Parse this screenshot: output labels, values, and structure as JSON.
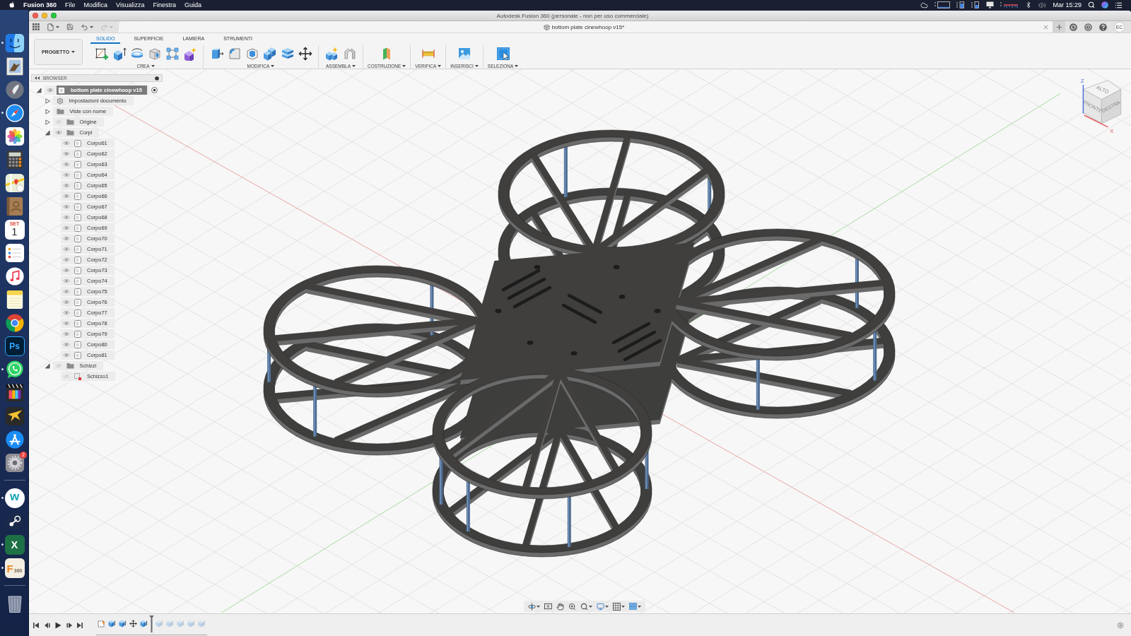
{
  "menu_bar": {
    "app_name": "Fusion 360",
    "menus": [
      "File",
      "Modifica",
      "Visualizza",
      "Finestra",
      "Guida"
    ],
    "clock": "Mar 15:29"
  },
  "dock": {
    "apps": [
      {
        "kind": "face",
        "running": true
      },
      {
        "kind": "stamp",
        "running": false
      },
      {
        "kind": "rocket",
        "running": false
      },
      {
        "kind": "compass",
        "running": true
      },
      {
        "kind": "flower",
        "running": false
      },
      {
        "kind": "calculator",
        "running": false
      },
      {
        "kind": "map",
        "running": false
      },
      {
        "kind": "book",
        "running": false
      },
      {
        "kind": "calendar",
        "month": "SET",
        "day": "1",
        "running": false
      },
      {
        "kind": "checklist",
        "running": false
      },
      {
        "kind": "note",
        "running": false
      },
      {
        "kind": "notepad",
        "running": false
      },
      {
        "kind": "wheel",
        "running": false
      },
      {
        "kind": "outlined-letter",
        "text": "Ps",
        "running": false
      },
      {
        "kind": "chat",
        "running": true
      },
      {
        "kind": "film",
        "running": false
      },
      {
        "kind": "bird",
        "running": false
      },
      {
        "kind": "sticks",
        "running": false
      },
      {
        "kind": "gear",
        "badge": "2",
        "running": false
      }
    ],
    "recent": [
      {
        "kind": "letter-circle",
        "text": "w",
        "running": true
      },
      {
        "kind": "linked-circles",
        "running": false
      },
      {
        "kind": "sheet-letter",
        "text": "X",
        "running": true
      },
      {
        "kind": "cream-letter",
        "text": "F",
        "subtext": "360",
        "running": true
      }
    ]
  },
  "window": {
    "title": "Autodesk Fusion 360 (personale - non per uso commerciale)"
  },
  "quick_access": [
    {
      "kind": "apps",
      "menu": false,
      "disabled": false
    },
    {
      "kind": "file",
      "menu": true,
      "disabled": false
    },
    {
      "kind": "save",
      "menu": false,
      "disabled": false
    },
    {
      "kind": "undo",
      "menu": true,
      "disabled": false
    },
    {
      "kind": "redo",
      "menu": true,
      "disabled": true
    }
  ],
  "document_tab": {
    "label": "bottom plate cinewhoop v15*"
  },
  "account": {
    "initials": "EC"
  },
  "toolbar": {
    "project": "PROGETTO",
    "tabs": [
      {
        "label": "SOLIDO",
        "selected": true
      },
      {
        "label": "SUPERFICIE",
        "selected": false
      },
      {
        "label": "LAMIERA",
        "selected": false
      },
      {
        "label": "STRUMENTI",
        "selected": false
      }
    ],
    "groups": [
      {
        "label": "CREA",
        "tools": [
          {
            "kind": "sketch"
          },
          {
            "kind": "extrude"
          },
          {
            "kind": "revolve"
          },
          {
            "kind": "hole"
          },
          {
            "kind": "pattern"
          },
          {
            "kind": "form"
          }
        ]
      },
      {
        "label": "MODIFICA",
        "tools": [
          {
            "kind": "press-pull"
          },
          {
            "kind": "fillet"
          },
          {
            "kind": "shell"
          },
          {
            "kind": "combine"
          },
          {
            "kind": "offset"
          },
          {
            "kind": "move"
          }
        ]
      },
      {
        "label": "ASSEMBLA",
        "tools": [
          {
            "kind": "component"
          },
          {
            "kind": "joint"
          }
        ]
      },
      {
        "label": "COSTRUZIONE",
        "tools": [
          {
            "kind": "plane"
          }
        ]
      },
      {
        "label": "VERIFICA",
        "tools": [
          {
            "kind": "measure"
          }
        ]
      },
      {
        "label": "INSERISCI",
        "tools": [
          {
            "kind": "image"
          }
        ]
      },
      {
        "label": "SELEZIONA",
        "tools": [
          {
            "kind": "select"
          }
        ]
      }
    ]
  },
  "browser": {
    "title": "BROWSER",
    "root": {
      "kind": "component",
      "label": "bottom plate cinewhoop v15",
      "expanded": true,
      "visible": true,
      "active": true,
      "children": [
        {
          "kind": "settings",
          "label": "Impostazioni documento",
          "expanded": false
        },
        {
          "kind": "folder",
          "label": "Viste con nome",
          "expanded": false
        },
        {
          "kind": "folder",
          "label": "Origine",
          "expanded": false,
          "visible": false
        },
        {
          "kind": "folder",
          "label": "Corpi",
          "expanded": true,
          "visible": true,
          "children": [
            {
              "kind": "body",
              "label": "Corpo61",
              "visible": true
            },
            {
              "kind": "body",
              "label": "Corpo62",
              "visible": true
            },
            {
              "kind": "body",
              "label": "Corpo63",
              "visible": true
            },
            {
              "kind": "body",
              "label": "Corpo64",
              "visible": true
            },
            {
              "kind": "body",
              "label": "Corpo65",
              "visible": true
            },
            {
              "kind": "body",
              "label": "Corpo66",
              "visible": true
            },
            {
              "kind": "body",
              "label": "Corpo67",
              "visible": true
            },
            {
              "kind": "body",
              "label": "Corpo68",
              "visible": true
            },
            {
              "kind": "body",
              "label": "Corpo69",
              "visible": true
            },
            {
              "kind": "body",
              "label": "Corpo70",
              "visible": true
            },
            {
              "kind": "body",
              "label": "Corpo71",
              "visible": true
            },
            {
              "kind": "body",
              "label": "Corpo72",
              "visible": true
            },
            {
              "kind": "body",
              "label": "Corpo73",
              "visible": true
            },
            {
              "kind": "body",
              "label": "Corpo74",
              "visible": true
            },
            {
              "kind": "body",
              "label": "Corpo75",
              "visible": true
            },
            {
              "kind": "body",
              "label": "Corpo76",
              "visible": true
            },
            {
              "kind": "body",
              "label": "Corpo77",
              "visible": true
            },
            {
              "kind": "body",
              "label": "Corpo78",
              "visible": true
            },
            {
              "kind": "body",
              "label": "Corpo79",
              "visible": true
            },
            {
              "kind": "body",
              "label": "Corpo80",
              "visible": true
            },
            {
              "kind": "body",
              "label": "Corpo81",
              "visible": true
            }
          ]
        },
        {
          "kind": "folder",
          "label": "Schizzi",
          "expanded": true,
          "visible": false,
          "children": [
            {
              "kind": "sketch",
              "label": "Schizzo1",
              "visible": false
            }
          ]
        }
      ]
    }
  },
  "viewcube": {
    "top": "ALTO",
    "front": "FRONTE",
    "right": "DESTRA",
    "axis_vertical": "Z",
    "axis_horizontal": "X"
  },
  "navigation_bar": {
    "tools": [
      {
        "kind": "orbit",
        "menu": true
      },
      {
        "kind": "look-at",
        "menu": false
      },
      {
        "kind": "pan",
        "menu": false
      },
      {
        "kind": "zoom",
        "menu": false
      },
      {
        "kind": "fit",
        "menu": true
      },
      {
        "kind": "display",
        "menu": true
      },
      {
        "kind": "grid",
        "menu": true
      },
      {
        "kind": "viewports",
        "menu": true
      }
    ]
  },
  "timeline": {
    "features": [
      {
        "kind": "sketch",
        "rolled_back": false
      },
      {
        "kind": "extrude",
        "rolled_back": false
      },
      {
        "kind": "extrude",
        "rolled_back": false
      },
      {
        "kind": "move",
        "rolled_back": false
      },
      {
        "kind": "extrude",
        "rolled_back": false
      },
      {
        "kind": "extrude",
        "rolled_back": true
      },
      {
        "kind": "extrude",
        "rolled_back": true
      },
      {
        "kind": "extrude",
        "rolled_back": true
      },
      {
        "kind": "extrude",
        "rolled_back": true
      },
      {
        "kind": "extrude",
        "rolled_back": true
      }
    ]
  }
}
